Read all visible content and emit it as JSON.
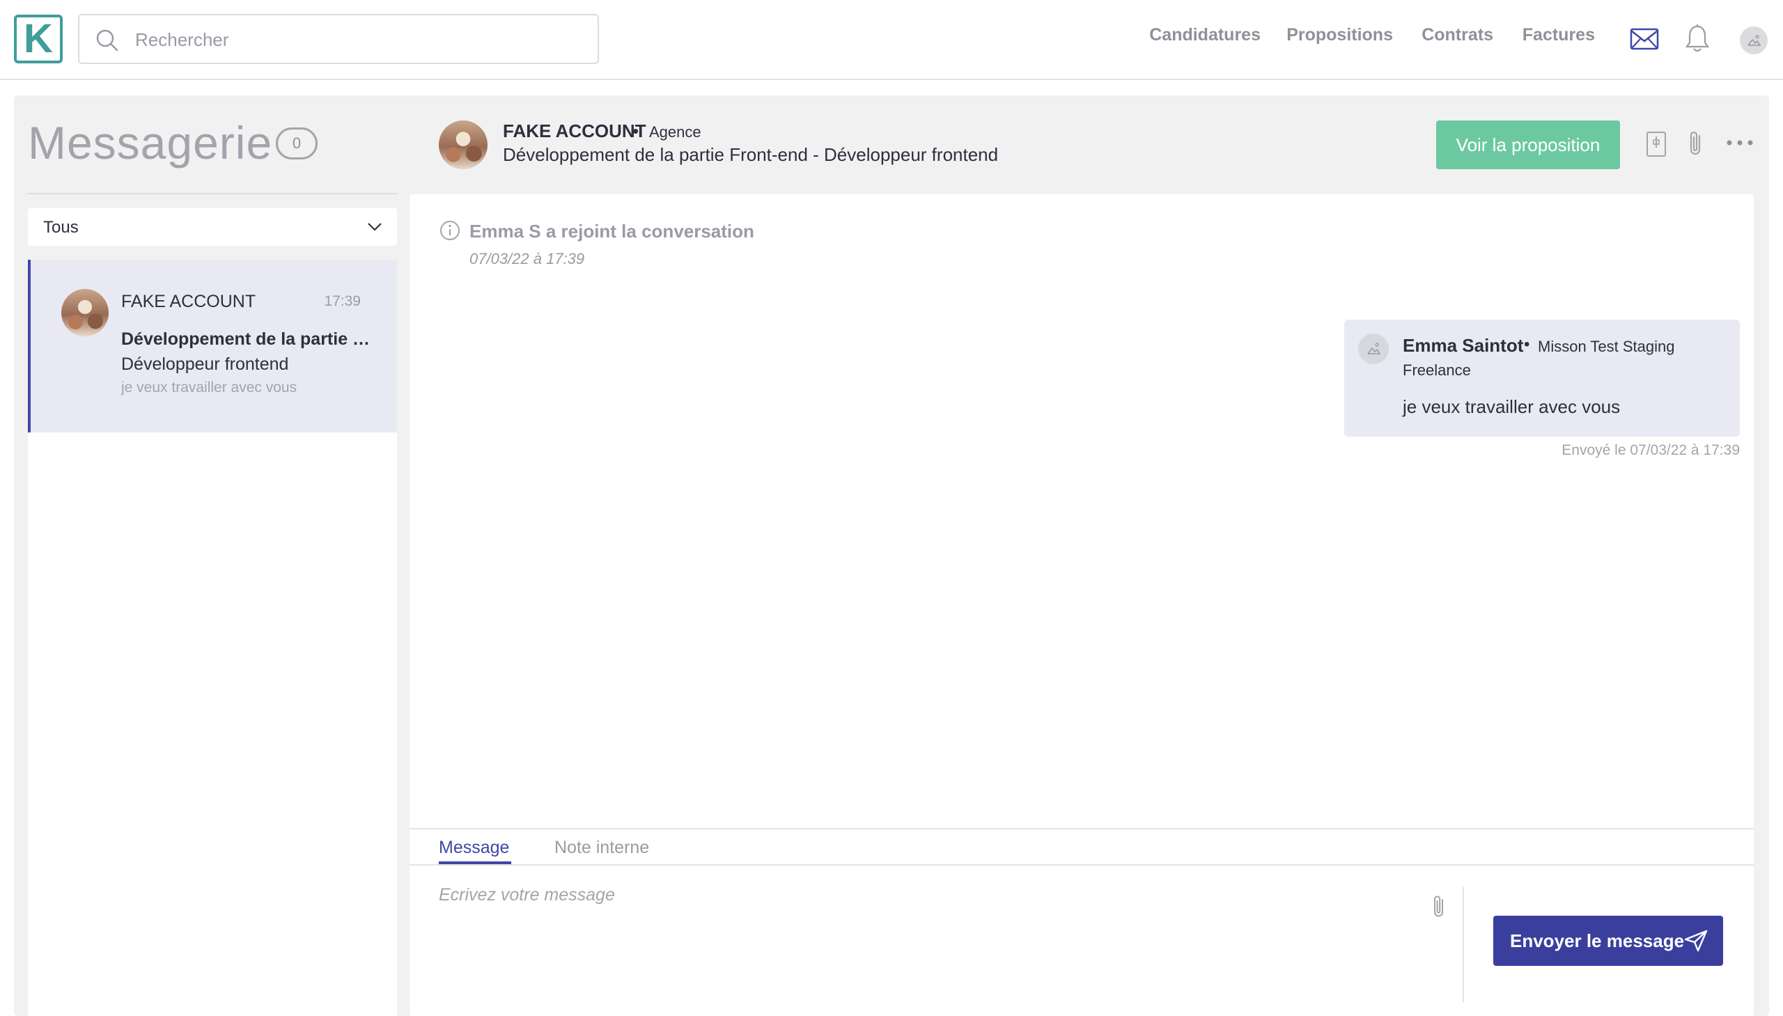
{
  "logo": {
    "letter": "K"
  },
  "search": {
    "placeholder": "Rechercher"
  },
  "nav": {
    "links": [
      "Candidatures",
      "Propositions",
      "Contrats",
      "Factures"
    ],
    "icons": [
      "mail-icon",
      "bell-icon",
      "user-avatar-icon"
    ]
  },
  "sidebar": {
    "title": "Messagerie",
    "count": "0",
    "filter": {
      "selected": "Tous"
    },
    "conversations": [
      {
        "name": "FAKE ACCOUNT",
        "time": "17:39",
        "subject": "Développement de la partie Front-end",
        "role": "Développeur frontend",
        "preview": "je veux travailler avec vous"
      }
    ]
  },
  "conversation": {
    "header": {
      "name": "FAKE ACCOUNT",
      "bullet": "•",
      "role": "Agence",
      "title": "Développement de la partie Front-end - Développeur frontend",
      "proposal_button": "Voir la proposition"
    },
    "system_event": {
      "text": "Emma S a rejoint la conversation",
      "date": "07/03/22 à 17:39"
    },
    "messages": [
      {
        "sender": "Emma Saintot",
        "bullet": "•",
        "mission": "Misson Test Staging",
        "role": "Freelance",
        "body": "je veux travailler avec vous",
        "sent_meta": "Envoyé le 07/03/22 à 17:39"
      }
    ]
  },
  "composer": {
    "tabs": [
      "Message",
      "Note interne"
    ],
    "active_tab": "Message",
    "placeholder": "Ecrivez votre message",
    "send_label": "Envoyer le message"
  },
  "colors": {
    "accent": "#3a3f9e",
    "proposal": "#6cc99f",
    "logo": "#3f9e9a",
    "selected_bg": "#e8e9f3"
  }
}
